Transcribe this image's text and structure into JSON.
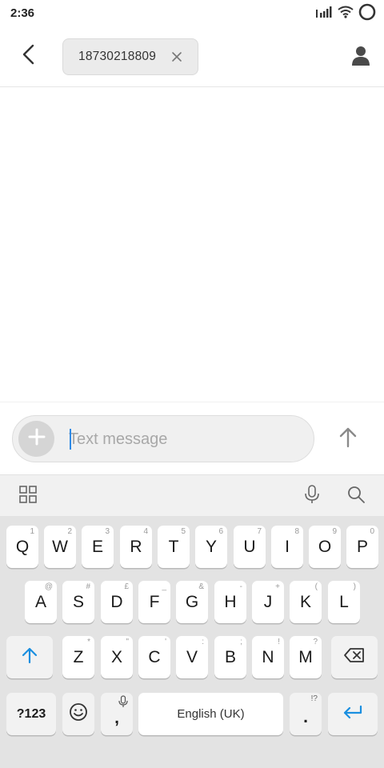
{
  "status_bar": {
    "time": "2:36",
    "icons": [
      "signal-icon",
      "wifi-icon",
      "battery-ring-icon"
    ]
  },
  "header": {
    "recipient": "18730218809",
    "icons": [
      "back-arrow-icon",
      "close-icon",
      "person-icon"
    ]
  },
  "compose": {
    "placeholder": "Text message",
    "value": "",
    "icons": [
      "plus-icon",
      "send-arrow-icon"
    ]
  },
  "keyboard_toolbar": {
    "icons": [
      "grid-menu-icon",
      "microphone-icon",
      "search-icon"
    ]
  },
  "keyboard": {
    "row1": [
      {
        "key": "Q",
        "hint": "1"
      },
      {
        "key": "W",
        "hint": "2"
      },
      {
        "key": "E",
        "hint": "3"
      },
      {
        "key": "R",
        "hint": "4"
      },
      {
        "key": "T",
        "hint": "5"
      },
      {
        "key": "Y",
        "hint": "6"
      },
      {
        "key": "U",
        "hint": "7"
      },
      {
        "key": "I",
        "hint": "8"
      },
      {
        "key": "O",
        "hint": "9"
      },
      {
        "key": "P",
        "hint": "0"
      }
    ],
    "row2": [
      {
        "key": "A",
        "hint": "@"
      },
      {
        "key": "S",
        "hint": "#"
      },
      {
        "key": "D",
        "hint": "£"
      },
      {
        "key": "F",
        "hint": "_"
      },
      {
        "key": "G",
        "hint": "&"
      },
      {
        "key": "H",
        "hint": "-"
      },
      {
        "key": "J",
        "hint": "+"
      },
      {
        "key": "K",
        "hint": "("
      },
      {
        "key": "L",
        "hint": ")"
      }
    ],
    "row3": [
      {
        "key": "Z",
        "hint": "*"
      },
      {
        "key": "X",
        "hint": "\""
      },
      {
        "key": "C",
        "hint": "'"
      },
      {
        "key": "V",
        "hint": ":"
      },
      {
        "key": "B",
        "hint": ";"
      },
      {
        "key": "N",
        "hint": "!"
      },
      {
        "key": "M",
        "hint": "?"
      }
    ],
    "symbols_label": "?123",
    "comma_label": ",",
    "space_label": "English (UK)",
    "period_label": ".",
    "period_hint": "!?",
    "accent_color": "#1a8fe0",
    "special_icons": [
      "shift-arrow-icon",
      "backspace-icon",
      "emoji-icon",
      "mic-small-icon",
      "enter-icon"
    ]
  }
}
